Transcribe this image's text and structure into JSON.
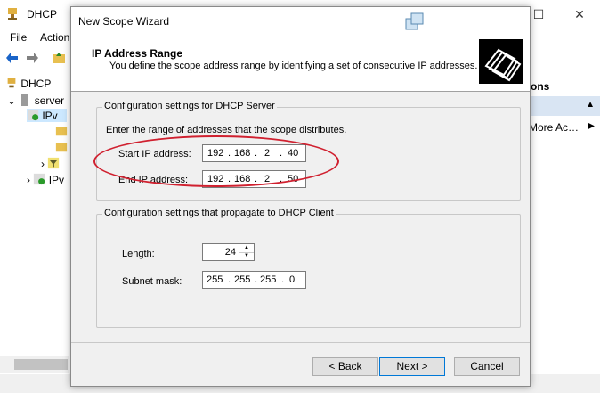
{
  "background_window": {
    "title": "DHCP",
    "menu": [
      "File",
      "Action"
    ],
    "tree": {
      "root": "DHCP",
      "server": "server",
      "ipv4": "IPv",
      "ipv6": "IPv"
    },
    "actions_header": "ons",
    "more_actions": "More Ac…"
  },
  "wizard": {
    "title": "New Scope Wizard",
    "header_title": "IP Address Range",
    "header_subtitle": "You define the scope address range by identifying a set of consecutive IP addresses.",
    "server_group": {
      "legend": "Configuration settings for DHCP Server",
      "instruction": "Enter the range of addresses that the scope distributes.",
      "start_label": "Start IP address:",
      "start_ip": [
        "192",
        "168",
        "2",
        "40"
      ],
      "end_label": "End IP address:",
      "end_ip": [
        "192",
        "168",
        "2",
        "50"
      ]
    },
    "client_group": {
      "legend": "Configuration settings that propagate to DHCP Client",
      "length_label": "Length:",
      "length_value": "24",
      "mask_label": "Subnet mask:",
      "mask": [
        "255",
        "255",
        "255",
        "0"
      ]
    },
    "buttons": {
      "back": "< Back",
      "next": "Next >",
      "cancel": "Cancel"
    }
  },
  "colors": {
    "annotation": "#d0202f",
    "dialog_bg": "#f0f0f0",
    "default_button_border": "#0078d7"
  }
}
